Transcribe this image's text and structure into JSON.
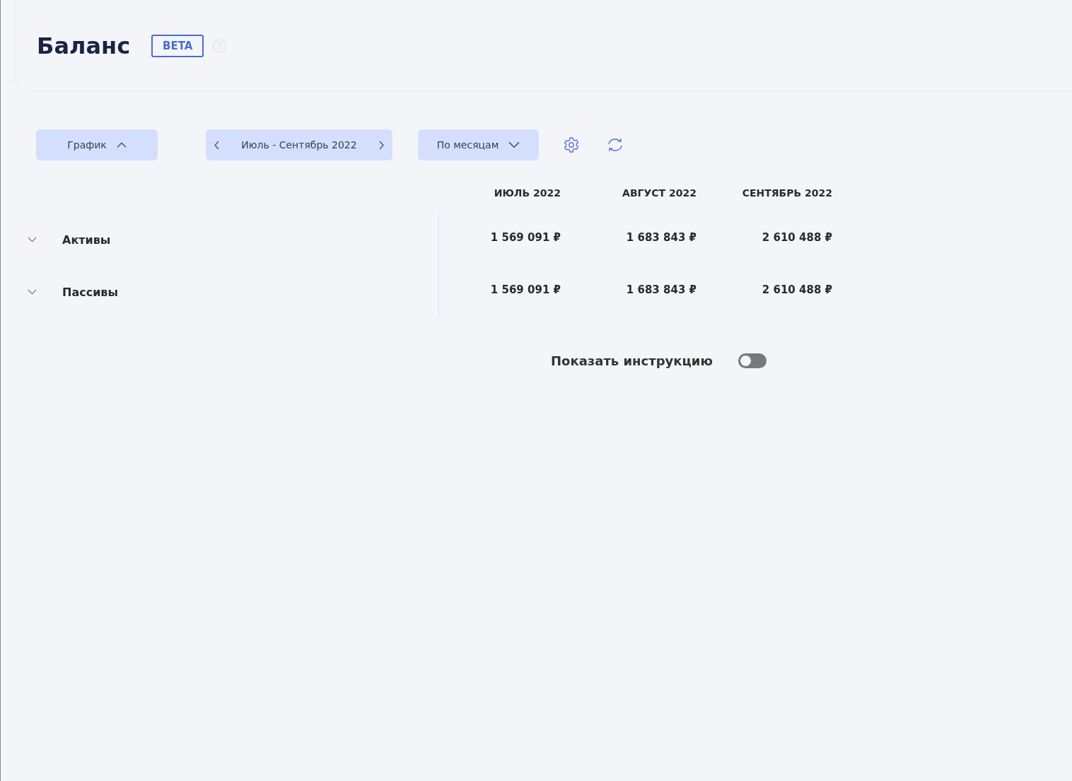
{
  "header": {
    "title": "Баланс",
    "badge": "BETA"
  },
  "toolbar": {
    "chart_button": {
      "label": "График",
      "expanded": true
    },
    "period": {
      "label": "Июль - Сентябрь 2022"
    },
    "grouping": {
      "label": "По месяцам",
      "expanded": false
    }
  },
  "table": {
    "columns": [
      "ИЮЛЬ 2022",
      "АВГУСТ 2022",
      "СЕНТЯБРЬ 2022"
    ],
    "rows": [
      {
        "label": "Активы",
        "expanded": false,
        "values": [
          "1 569 091 ₽",
          "1 683 843 ₽",
          "2 610 488 ₽"
        ]
      },
      {
        "label": "Пассивы",
        "expanded": false,
        "values": [
          "1 569 091 ₽",
          "1 683 843 ₽",
          "2 610 488 ₽"
        ]
      }
    ]
  },
  "instruction_toggle": {
    "label": "Показать инструкцию",
    "on": false
  }
}
